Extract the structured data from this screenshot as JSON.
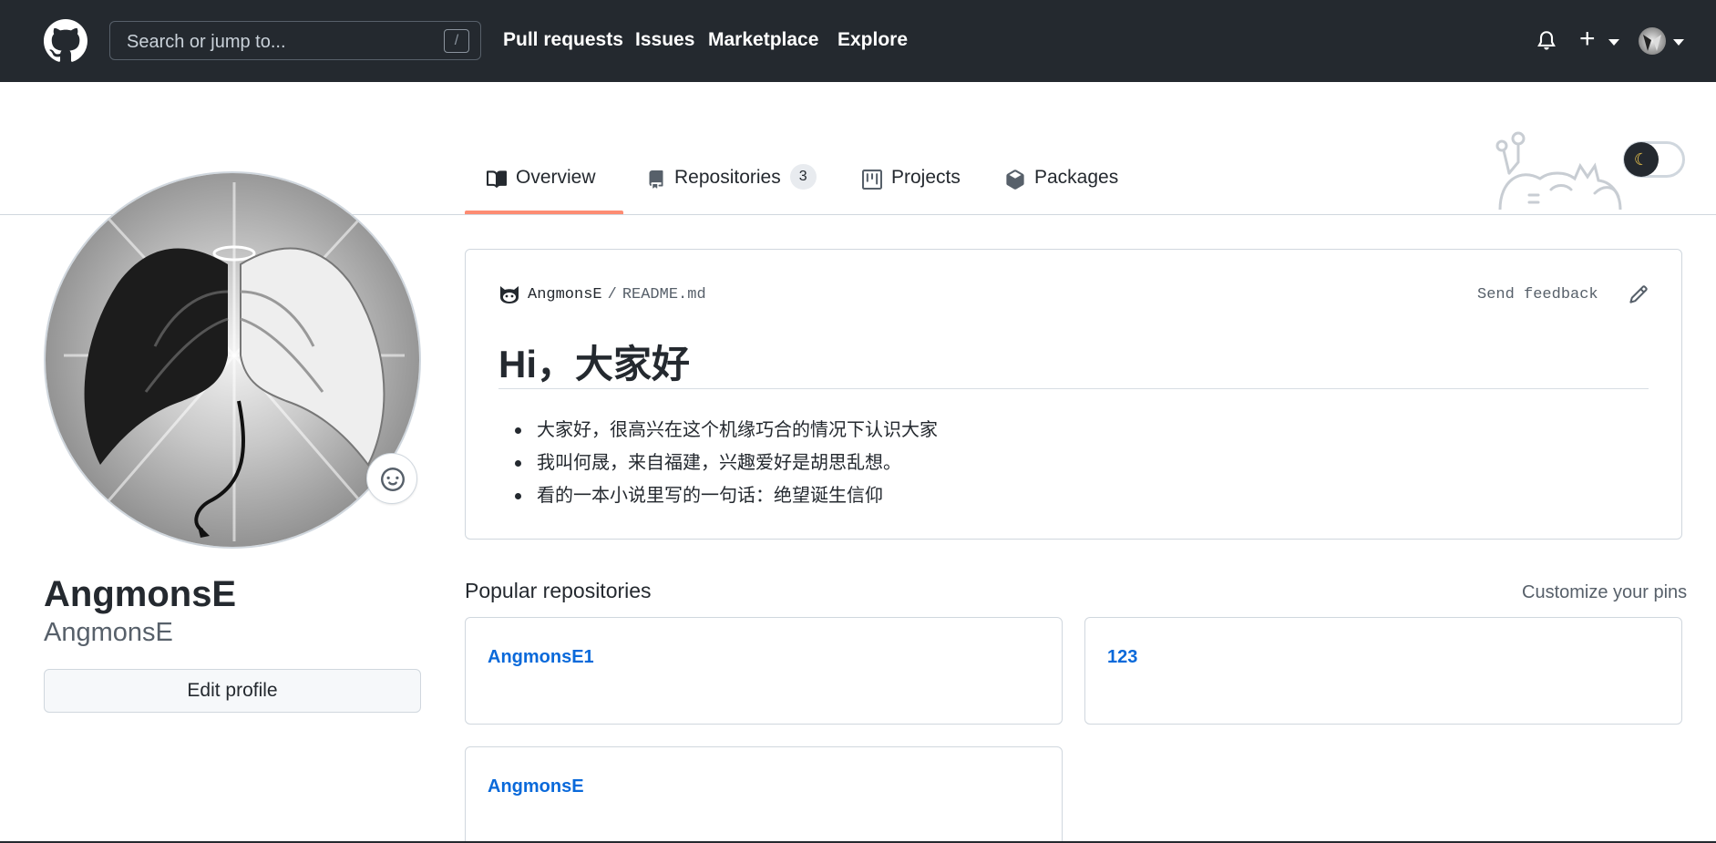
{
  "header": {
    "search_placeholder": "Search or jump to...",
    "search_shortcut": "/",
    "nav": [
      "Pull requests",
      "Issues",
      "Marketplace",
      "Explore"
    ]
  },
  "tabs": [
    {
      "label": "Overview",
      "icon": "book-icon",
      "selected": true
    },
    {
      "label": "Repositories",
      "icon": "repo-icon",
      "count": "3"
    },
    {
      "label": "Projects",
      "icon": "project-icon"
    },
    {
      "label": "Packages",
      "icon": "package-icon"
    }
  ],
  "profile": {
    "name": "AngmonsE",
    "login": "AngmonsE",
    "edit_label": "Edit profile"
  },
  "readme": {
    "owner": "AngmonsE",
    "separator": "/",
    "file": "README.md",
    "feedback": "Send feedback",
    "heading": "Hi，大家好",
    "items": [
      "大家好，很高兴在这个机缘巧合的情况下认识大家",
      "我叫何晟，来自福建，兴趣爱好是胡思乱想。",
      "看的一本小说里写的一句话：绝望诞生信仰"
    ]
  },
  "popular": {
    "title": "Popular repositories",
    "customize": "Customize your pins",
    "repos": [
      "AngmonsE1",
      "123",
      "AngmonsE"
    ]
  },
  "theme": {
    "header_bg": "#24292f",
    "accent_underline": "#fd8c73",
    "link": "#0969da"
  }
}
